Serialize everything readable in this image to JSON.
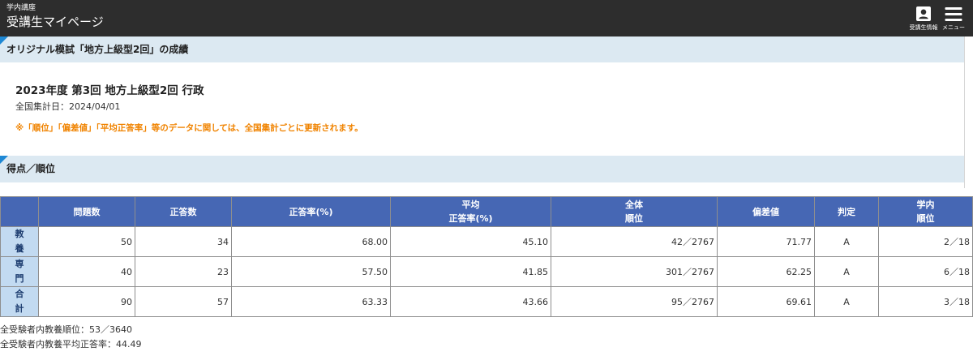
{
  "header": {
    "subtitle": "学内講座",
    "title": "受講生マイページ",
    "profile_label": "受講生情報",
    "menu_label": "メニュー"
  },
  "icons": {
    "profile": "profile-card-icon",
    "menu": "hamburger-menu-icon"
  },
  "results": {
    "heading": "オリジナル模試「地方上級型2回」の成績",
    "exam_title": "2023年度 第3回 地方上級型2回 行政",
    "aggregation_date": "全国集計日：2024/04/01",
    "notice": "※「順位」「偏差値」「平均正答率」等のデータに関しては、全国集計ごとに更新されます。"
  },
  "scores": {
    "heading": "得点／順位",
    "columns": [
      {
        "lines": [
          "問題数"
        ]
      },
      {
        "lines": [
          "正答数"
        ]
      },
      {
        "lines": [
          "正答率(%)"
        ]
      },
      {
        "lines": [
          "平均",
          "正答率(%)"
        ]
      },
      {
        "lines": [
          "全体",
          "順位"
        ]
      },
      {
        "lines": [
          "偏差値"
        ]
      },
      {
        "lines": [
          "判定"
        ]
      },
      {
        "lines": [
          "学内",
          "順位"
        ]
      }
    ],
    "rows": [
      {
        "label": "教養",
        "questions": "50",
        "correct": "34",
        "rate": "68.00",
        "avg_rate": "45.10",
        "overall_rank": "42／2767",
        "deviation": "71.77",
        "judgement": "A",
        "school_rank": "2／18"
      },
      {
        "label": "専門",
        "questions": "40",
        "correct": "23",
        "rate": "57.50",
        "avg_rate": "41.85",
        "overall_rank": "301／2767",
        "deviation": "62.25",
        "judgement": "A",
        "school_rank": "6／18"
      },
      {
        "label": "合計",
        "questions": "90",
        "correct": "57",
        "rate": "63.33",
        "avg_rate": "43.66",
        "overall_rank": "95／2767",
        "deviation": "69.61",
        "judgement": "A",
        "school_rank": "3／18"
      }
    ]
  },
  "summary": {
    "general_rank": "全受験者内教養順位：53／3640",
    "general_avg_rate": "全受験者内教養平均正答率：44.49"
  },
  "colors": {
    "header_bg": "#2d2d2d",
    "section_bg": "#dce9f2",
    "accent": "#1e88d4",
    "table_header_bg": "#4667b4",
    "row_header_bg": "#c2daf1",
    "notice": "#f08300"
  }
}
